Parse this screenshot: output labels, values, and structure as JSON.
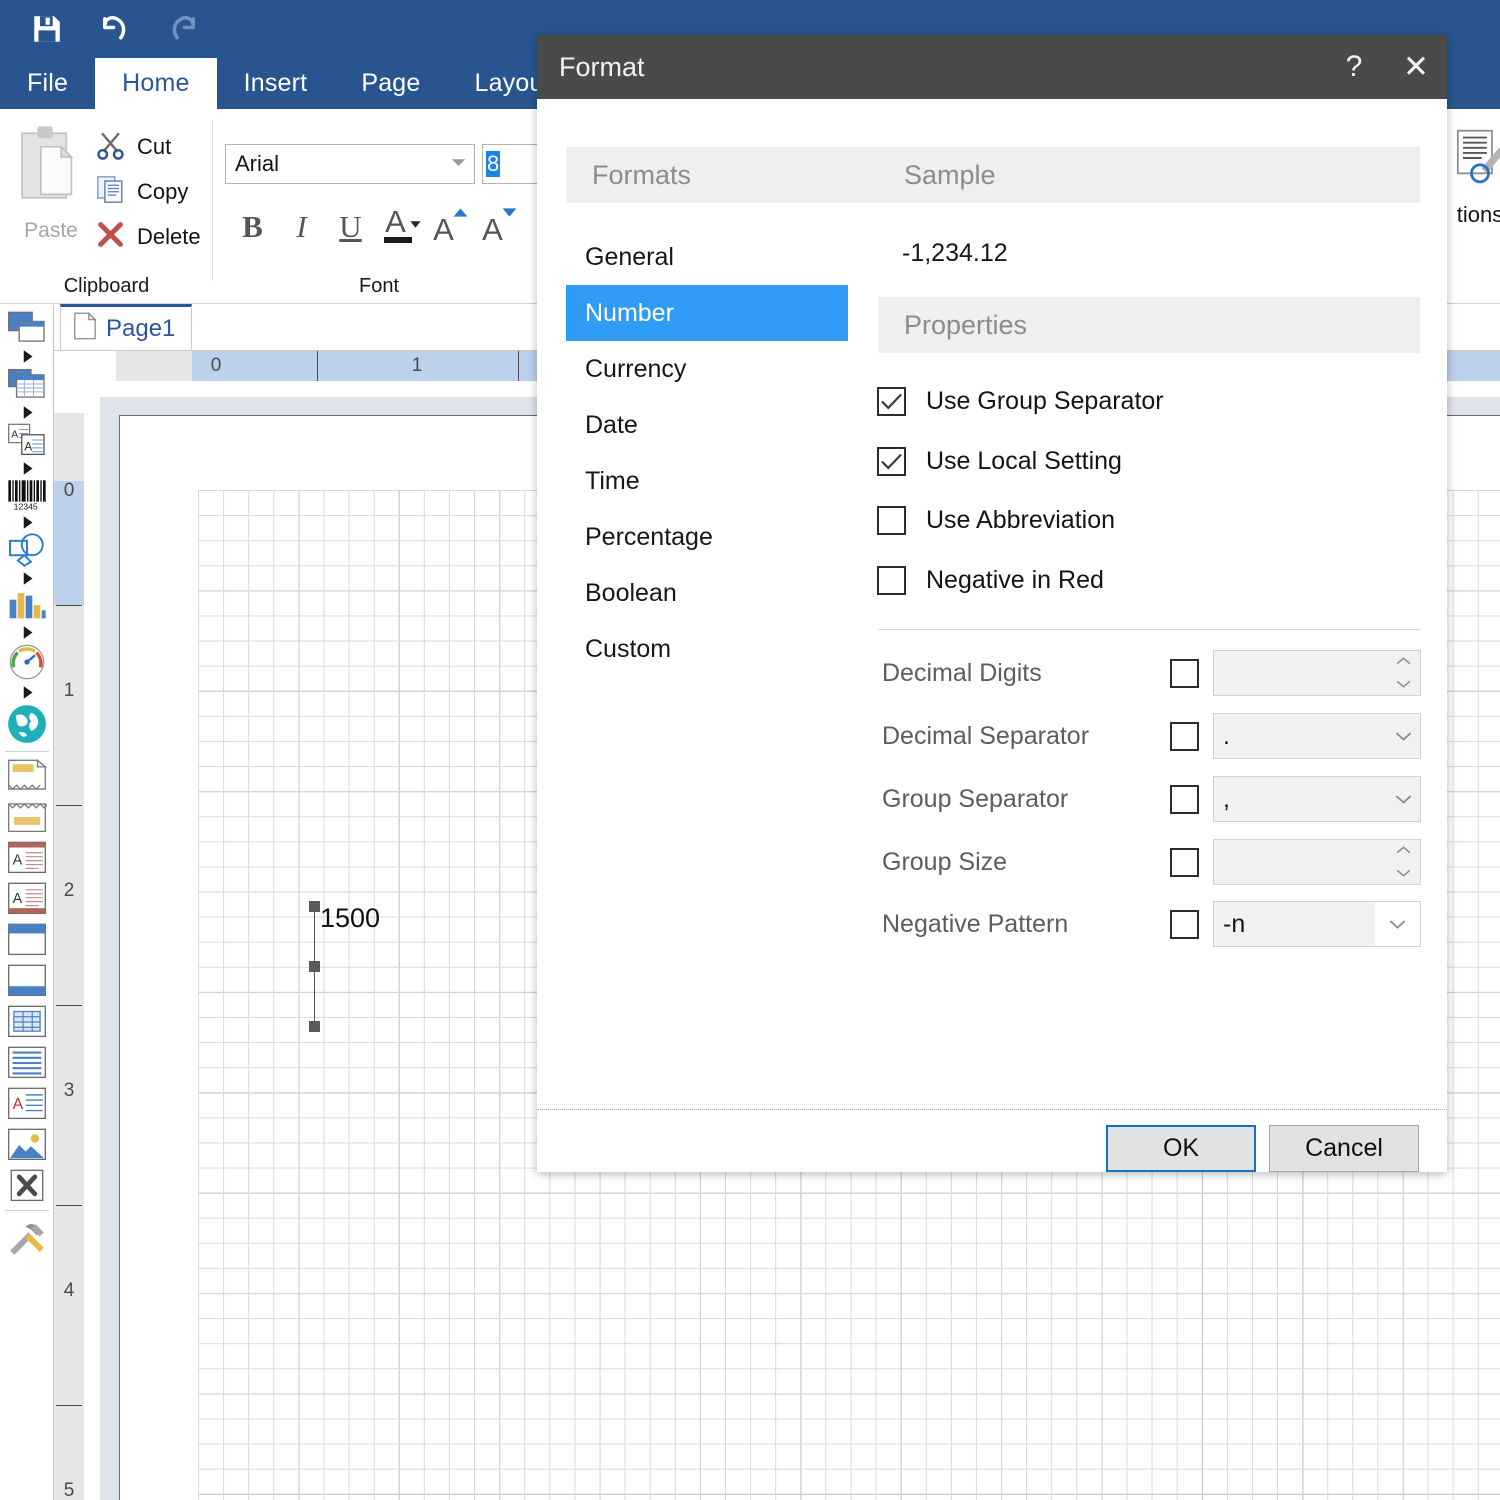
{
  "app": {
    "quick_access": [
      {
        "name": "save-icon",
        "label": "Save"
      },
      {
        "name": "undo-icon",
        "label": "Undo"
      },
      {
        "name": "redo-icon",
        "label": "Redo"
      }
    ],
    "tabs": [
      {
        "label": "File",
        "active": false
      },
      {
        "label": "Home",
        "active": true
      },
      {
        "label": "Insert",
        "active": false
      },
      {
        "label": "Page",
        "active": false
      },
      {
        "label": "Layout",
        "active": false
      }
    ]
  },
  "ribbon": {
    "clipboard": {
      "group_label": "Clipboard",
      "paste_label": "Paste",
      "items": [
        {
          "label": "Cut",
          "icon": "scissors-icon"
        },
        {
          "label": "Copy",
          "icon": "copy-icon"
        },
        {
          "label": "Delete",
          "icon": "delete-x-icon"
        }
      ]
    },
    "font": {
      "group_label": "Font",
      "font_name": "Arial",
      "font_size": "8",
      "buttons": [
        {
          "label": "B",
          "name": "bold-button"
        },
        {
          "label": "I",
          "name": "italic-button"
        },
        {
          "label": "U",
          "name": "underline-button"
        },
        {
          "label": "A",
          "name": "font-color-button"
        },
        {
          "label": "A",
          "name": "grow-font-button"
        },
        {
          "label": "A",
          "name": "shrink-font-button"
        }
      ]
    },
    "right_group": {
      "label": "tions"
    }
  },
  "document": {
    "page_tab": "Page1",
    "shape_text": "1500",
    "h_ruler_labels": [
      "0",
      "1"
    ],
    "v_ruler_labels": [
      "0",
      "1",
      "2",
      "3",
      "4",
      "5"
    ]
  },
  "palette": {
    "items": [
      {
        "name": "tool-shapes",
        "has_arrow": true
      },
      {
        "name": "tool-tables",
        "has_arrow": true
      },
      {
        "name": "tool-text-boxes",
        "has_arrow": true
      },
      {
        "name": "tool-barcode",
        "has_arrow": true
      },
      {
        "name": "tool-vector-shapes",
        "has_arrow": true
      },
      {
        "name": "tool-chart",
        "has_arrow": true
      },
      {
        "name": "tool-gauge",
        "has_arrow": true
      },
      {
        "name": "tool-map",
        "has_arrow": false
      },
      {
        "name": "tool-report-header",
        "has_arrow": false
      },
      {
        "name": "tool-report-footer",
        "has_arrow": false
      },
      {
        "name": "tool-page-header",
        "has_arrow": false
      },
      {
        "name": "tool-page-footer",
        "has_arrow": false
      },
      {
        "name": "tool-group-header",
        "has_arrow": false
      },
      {
        "name": "tool-group-footer",
        "has_arrow": false
      },
      {
        "name": "tool-detail-grid",
        "has_arrow": false
      },
      {
        "name": "tool-detail-band",
        "has_arrow": false
      },
      {
        "name": "tool-rich-text",
        "has_arrow": false
      },
      {
        "name": "tool-picture",
        "has_arrow": false
      },
      {
        "name": "tool-cross-section",
        "has_arrow": false
      },
      {
        "name": "tool-settings",
        "has_arrow": false
      }
    ]
  },
  "dialog": {
    "title": "Format",
    "help_glyph": "?",
    "close_glyph": "✕",
    "formats_header": "Formats",
    "sample_header": "Sample",
    "properties_header": "Properties",
    "sample_value": "-1,234.12",
    "format_options": [
      {
        "label": "General",
        "selected": false
      },
      {
        "label": "Number",
        "selected": true
      },
      {
        "label": "Currency",
        "selected": false
      },
      {
        "label": "Date",
        "selected": false
      },
      {
        "label": "Time",
        "selected": false
      },
      {
        "label": "Percentage",
        "selected": false
      },
      {
        "label": "Boolean",
        "selected": false
      },
      {
        "label": "Custom",
        "selected": false
      }
    ],
    "checkboxes": [
      {
        "label": "Use Group Separator",
        "checked": true
      },
      {
        "label": "Use Local Setting",
        "checked": true
      },
      {
        "label": "Use Abbreviation",
        "checked": false
      },
      {
        "label": "Negative in Red",
        "checked": false
      }
    ],
    "properties": [
      {
        "label": "Decimal Digits",
        "checked": false,
        "value": "",
        "control": "spinner"
      },
      {
        "label": "Decimal Separator",
        "checked": false,
        "value": ".",
        "control": "dropdown"
      },
      {
        "label": "Group Separator",
        "checked": false,
        "value": ",",
        "control": "dropdown"
      },
      {
        "label": "Group Size",
        "checked": false,
        "value": "",
        "control": "spinner"
      },
      {
        "label": "Negative Pattern",
        "checked": false,
        "value": "-n",
        "control": "dropdown-split"
      }
    ],
    "ok_label": "OK",
    "cancel_label": "Cancel"
  },
  "colors": {
    "ribbon_blue": "#28558f",
    "accent_blue": "#2f9bf5",
    "dialog_titlebar": "#4a4a48",
    "selection_blue": "#1a84e8",
    "focus_blue": "#1272c8"
  }
}
